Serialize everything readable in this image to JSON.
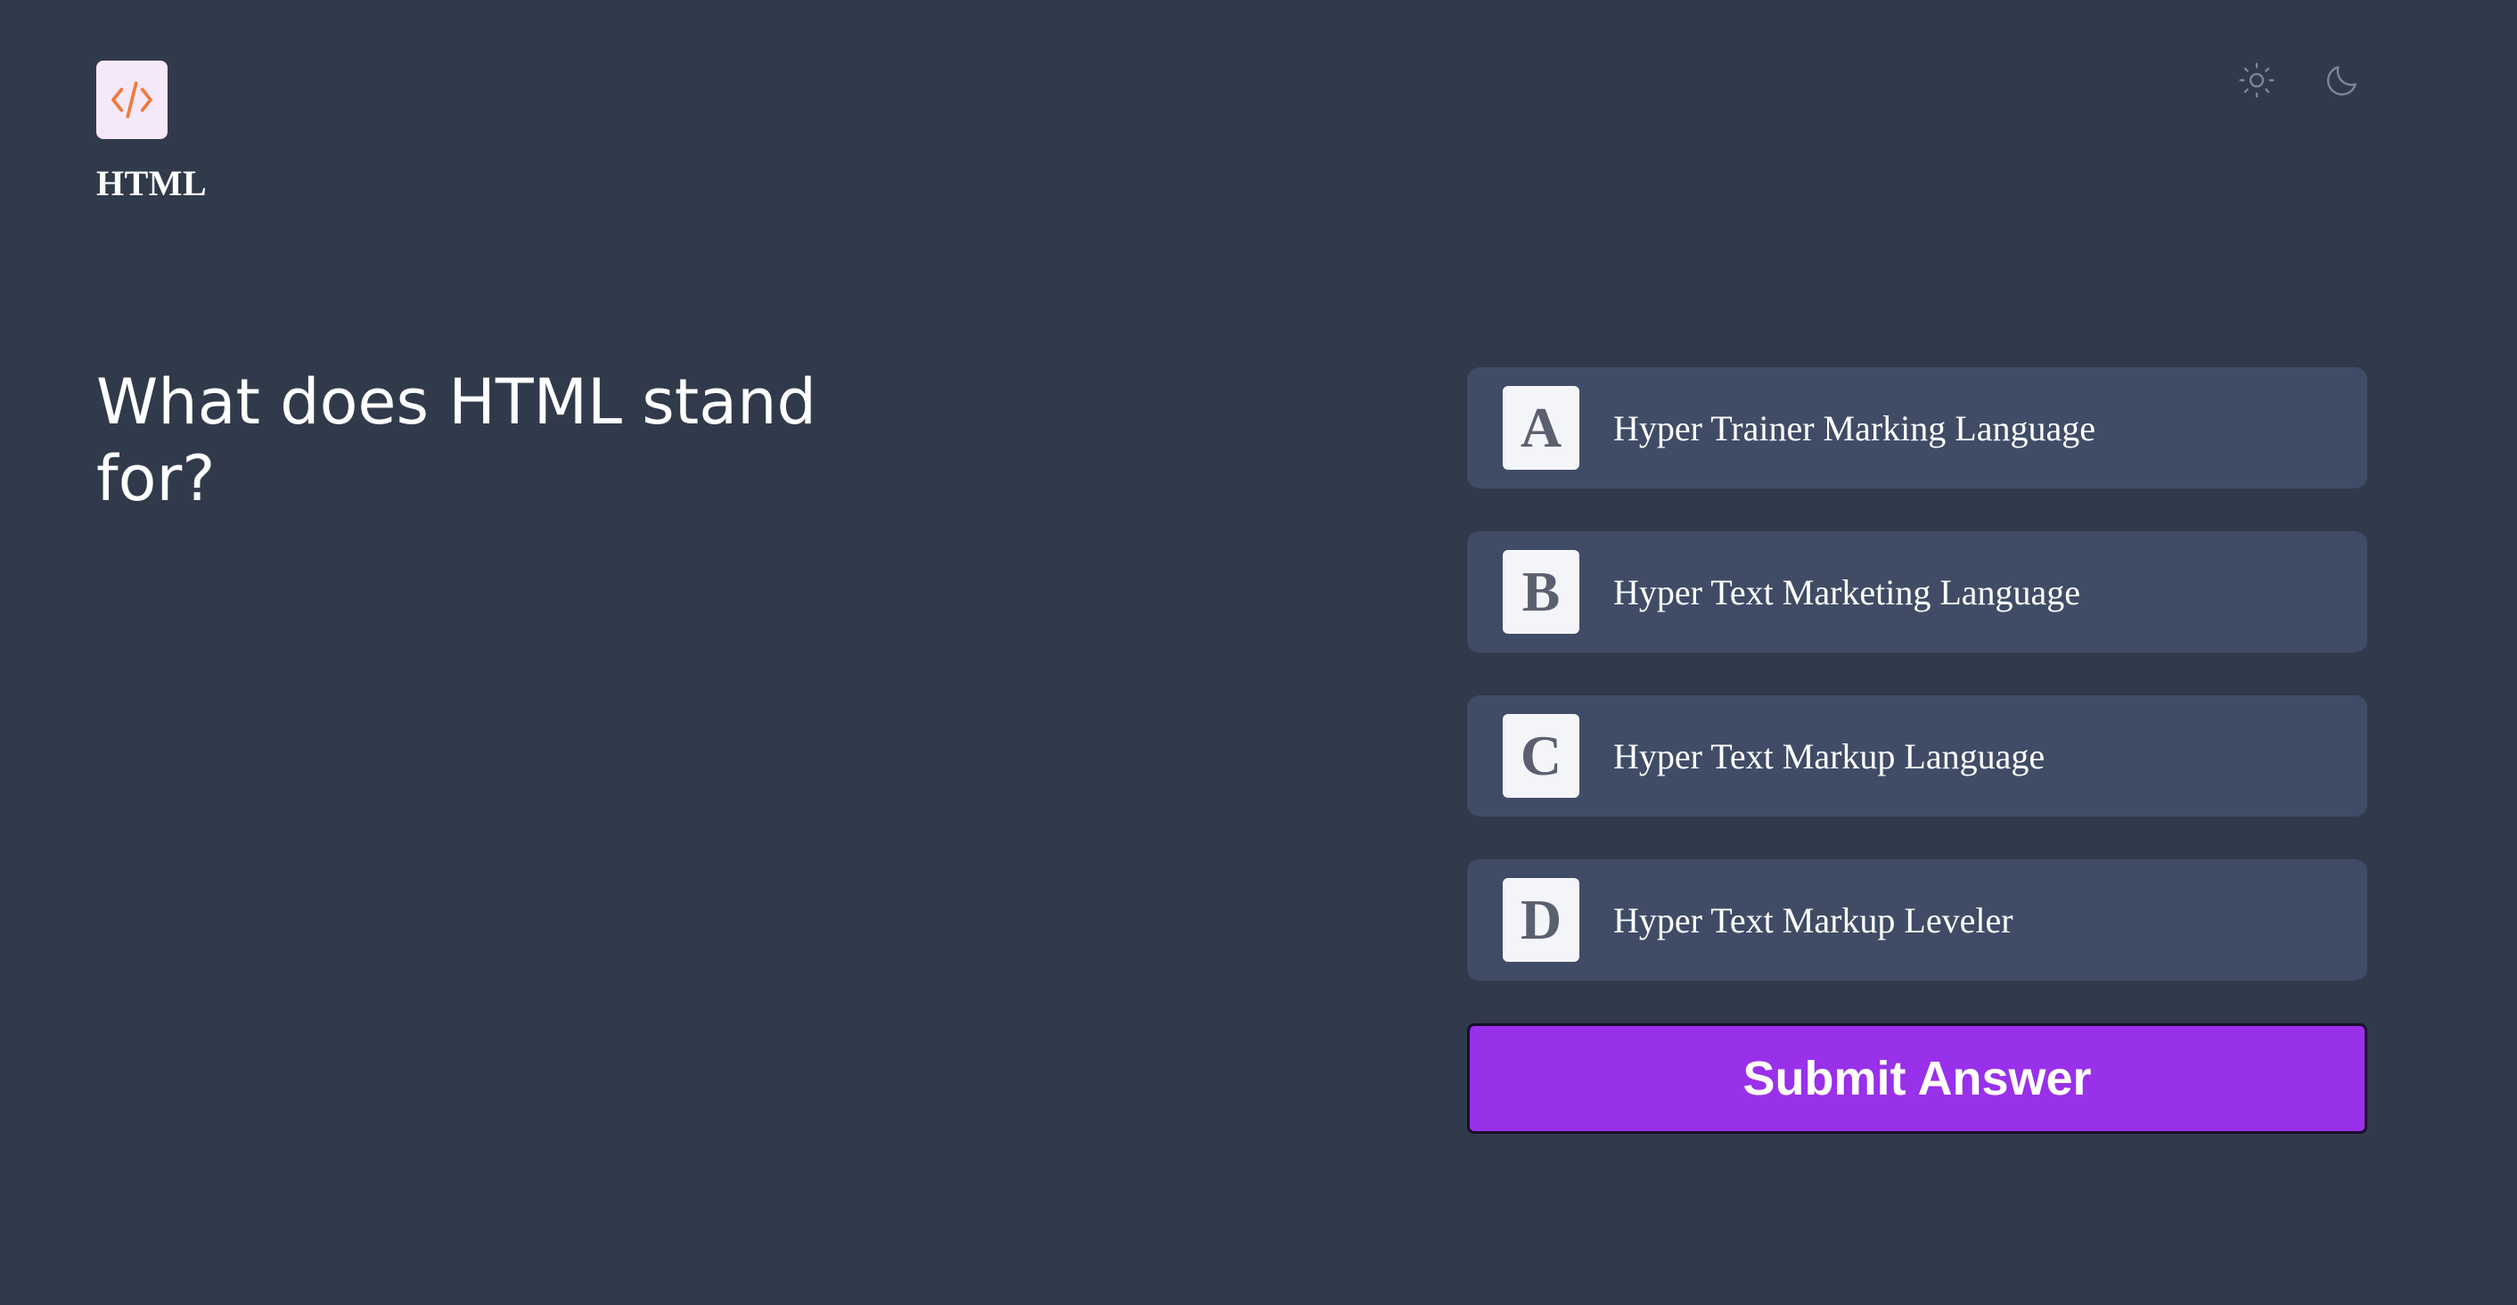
{
  "topic": {
    "title": "HTML",
    "icon": "code-icon",
    "icon_color": "#f07a3a",
    "icon_background": "#f6e8fb"
  },
  "theme_toggle": {
    "light_icon": "sun-icon",
    "dark_icon": "moon-icon"
  },
  "question": {
    "text": "What does HTML stand for?"
  },
  "options": [
    {
      "letter": "A",
      "text": "Hyper Trainer Marking Language"
    },
    {
      "letter": "B",
      "text": "Hyper Text Marketing Language"
    },
    {
      "letter": "C",
      "text": "Hyper Text Markup Language"
    },
    {
      "letter": "D",
      "text": "Hyper Text Markup Leveler"
    }
  ],
  "submit": {
    "label": "Submit Answer",
    "color": "#9930ea"
  },
  "colors": {
    "background": "#313a4b",
    "option_background": "#404c66"
  }
}
